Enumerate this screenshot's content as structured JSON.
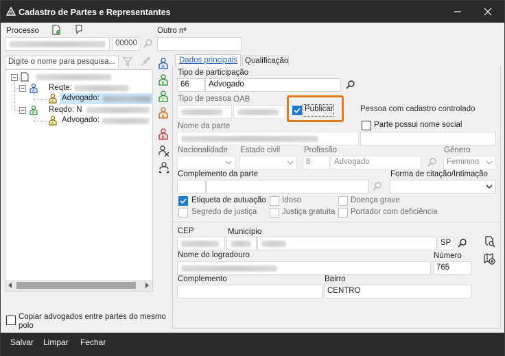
{
  "window": {
    "title": "Cadastro de Partes e Representantes"
  },
  "top": {
    "processo_label": "Processo",
    "processo_suffix": "00000",
    "outro_label": "Outro nº"
  },
  "search": {
    "placeholder": "Digite o nome para pesquisa..."
  },
  "tree": {
    "reqte_label": "Reqte:",
    "advogado1_label": "Advogado:",
    "reqdo_label": "Reqdo: N",
    "advogado2_label": "Advogado:"
  },
  "copy_checkbox": {
    "label": "Copiar advogados entre partes do mesmo polo"
  },
  "tabs": [
    {
      "label": "Dados principais",
      "active": true
    },
    {
      "label": "Qualificação",
      "active": false
    }
  ],
  "form": {
    "tipo_participacao_label": "Tipo de participação",
    "tipo_participacao_code": "66",
    "tipo_participacao_value": "Advogado",
    "tipo_pessoa_label": "Tipo de pessoa",
    "oab_label": "OAB",
    "publicar_label": "Publicar",
    "pessoa_controlado_label": "Pessoa com cadastro controlado",
    "nome_parte_label": "Nome da parte",
    "nome_social_label": "Parte possui nome social",
    "nacionalidade_label": "Nacionalidade",
    "estado_civil_label": "Estado civil",
    "profissao_label": "Profissão",
    "profissao_code": "8",
    "profissao_value": "Advogado",
    "genero_label": "Gênero",
    "genero_value": "Feminino",
    "complemento_parte_label": "Complemento da parte",
    "forma_citacao_label": "Forma de citação/Intimação",
    "etiqueta_label": "Etiqueta de autuação",
    "idoso_label": "Idoso",
    "doenca_label": "Doença grave",
    "segredo_label": "Segredo de justiça",
    "justica_gratuita_label": "Justiça gratuita",
    "portador_label": "Portador com deficiência",
    "cep_label": "CEP",
    "municipio_label": "Município",
    "uf_value": "SP",
    "logradouro_label": "Nome do logradouro",
    "numero_label": "Número",
    "numero_value": "765",
    "complemento_label": "Complemento",
    "bairro_label": "Bairro",
    "bairro_value": "CENTRO"
  },
  "footer": {
    "salvar": "Salvar",
    "limpar": "Limpar",
    "fechar": "Fechar"
  },
  "colors": {
    "accent": "#1f78d1",
    "highlight_box": "#e07b1a",
    "titlebar": "#2b2b2b"
  }
}
